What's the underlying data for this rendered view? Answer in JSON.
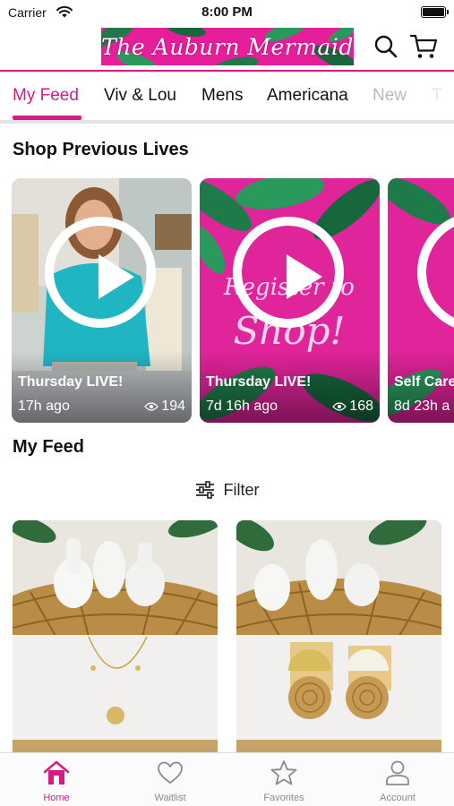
{
  "status_bar": {
    "carrier": "Carrier",
    "time": "8:00 PM"
  },
  "header": {
    "logo_text": "The Auburn Mermaid"
  },
  "tabs": [
    {
      "label": "My Feed"
    },
    {
      "label": "Viv & Lou"
    },
    {
      "label": "Mens"
    },
    {
      "label": "Americana"
    },
    {
      "label": "New"
    },
    {
      "label": "T"
    }
  ],
  "sections": {
    "previous_lives": "Shop Previous Lives",
    "my_feed": "My Feed"
  },
  "lives": [
    {
      "title": "Thursday LIVE!",
      "ago": "17h ago",
      "views": "194"
    },
    {
      "title": "Thursday LIVE!",
      "ago": "7d 16h ago",
      "views": "168"
    },
    {
      "title": "Self Care",
      "ago": "8d 23h a"
    }
  ],
  "filter": {
    "label": "Filter"
  },
  "bottom_nav": [
    {
      "label": "Home"
    },
    {
      "label": "Waitlist"
    },
    {
      "label": "Favorites"
    },
    {
      "label": "Account"
    }
  ],
  "colors": {
    "accent": "#d81b84",
    "nav_inactive": "#8a8a8a",
    "divider": "#e4e4e4"
  }
}
